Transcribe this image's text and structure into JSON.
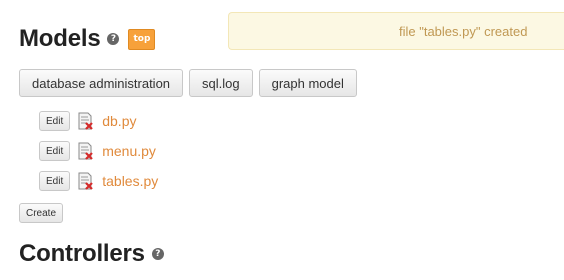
{
  "models": {
    "title": "Models",
    "help_icon": "question-circle-icon",
    "badge": "top"
  },
  "flash": {
    "message": "file \"tables.py\" created"
  },
  "toolbar": {
    "buttons": [
      {
        "label": "database administration"
      },
      {
        "label": "sql.log"
      },
      {
        "label": "graph model"
      }
    ]
  },
  "files": [
    {
      "edit_label": "Edit",
      "name": "db.py",
      "icon": "delete-file-icon"
    },
    {
      "edit_label": "Edit",
      "name": "menu.py",
      "icon": "delete-file-icon"
    },
    {
      "edit_label": "Edit",
      "name": "tables.py",
      "icon": "delete-file-icon"
    }
  ],
  "create_label": "Create",
  "controllers": {
    "title": "Controllers",
    "help_icon": "question-circle-icon"
  },
  "colors": {
    "link": "#e08a3c",
    "badge": "#f7a13a",
    "flash_bg": "#fcf8e3",
    "flash_text": "#c09853"
  }
}
